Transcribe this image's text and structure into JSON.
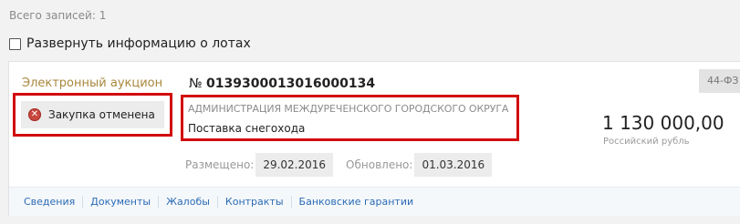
{
  "summary": {
    "total_records": "Всего записей: 1"
  },
  "expand": {
    "label": "Развернуть информацию о лотах",
    "checked": false
  },
  "record": {
    "procedure_type": "Электронный аукцион",
    "status": {
      "label": "Закупка отменена",
      "icon": "cancel-circle-icon",
      "color": "#c8473f"
    },
    "number_prefix": "№",
    "number": "0139300013016000134",
    "customer": "АДМИНИСТРАЦИЯ МЕЖДУРЕЧЕНСКОГО ГОРОДСКОГО ОКРУГА",
    "subject": "Поставка снегохода",
    "law": "44-ФЗ",
    "price": "1 130 000,00",
    "currency": "Российский рубль",
    "posted_label": "Размещено:",
    "posted_date": "29.02.2016",
    "updated_label": "Обновлено:",
    "updated_date": "01.03.2016",
    "links": [
      "Сведения",
      "Документы",
      "Жалобы",
      "Контракты",
      "Банковские гарантии"
    ]
  },
  "colors": {
    "highlight_border": "#d20c0c",
    "link": "#2a6bb4",
    "procedure_type": "#a8873c"
  }
}
